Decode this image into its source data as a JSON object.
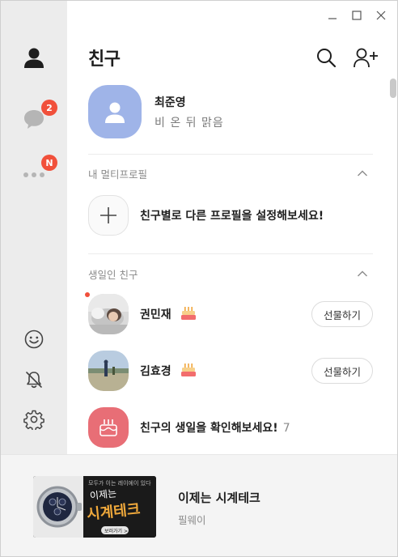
{
  "window": {
    "controls": [
      "minimize",
      "maximize",
      "close"
    ]
  },
  "sidebar": {
    "items": [
      {
        "name": "friends",
        "icon": "person-icon",
        "active": true
      },
      {
        "name": "chats",
        "icon": "chat-bubble-icon",
        "badge": "2"
      },
      {
        "name": "more",
        "icon": "more-dots-icon",
        "badge": "N"
      }
    ],
    "bottom": [
      {
        "name": "emoticon",
        "icon": "smiley-icon"
      },
      {
        "name": "notifications",
        "icon": "bell-off-icon"
      },
      {
        "name": "settings",
        "icon": "gear-icon"
      }
    ]
  },
  "header": {
    "title": "친구"
  },
  "my_profile": {
    "name": "최준영",
    "status": "비 온 뒤 맑음"
  },
  "multi_profile": {
    "label": "내 멀티프로필",
    "prompt": "친구별로 다른 프로필을 설정해보세요!"
  },
  "birthday": {
    "label": "생일인 친구",
    "friends": [
      {
        "name": "권민재",
        "action": "선물하기"
      },
      {
        "name": "김효경",
        "action": "선물하기"
      }
    ],
    "check_prompt": "친구의 생일을 확인해보세요!",
    "check_count": "7"
  },
  "ad": {
    "image_caption_top": "모두가 이는 레이에이 있다",
    "image_caption_main1": "이제는",
    "image_caption_main2": "시계테크",
    "image_button": "보러가기 >",
    "title": "이제는 시계테크",
    "subtitle": "필웨이"
  },
  "colors": {
    "sidebar_bg": "#ececec",
    "badge": "#f1503b",
    "my_avatar": "#9fb4e8",
    "birthday_icon_bg": "#e86e76",
    "ad_bg": "#f4f4f4"
  }
}
